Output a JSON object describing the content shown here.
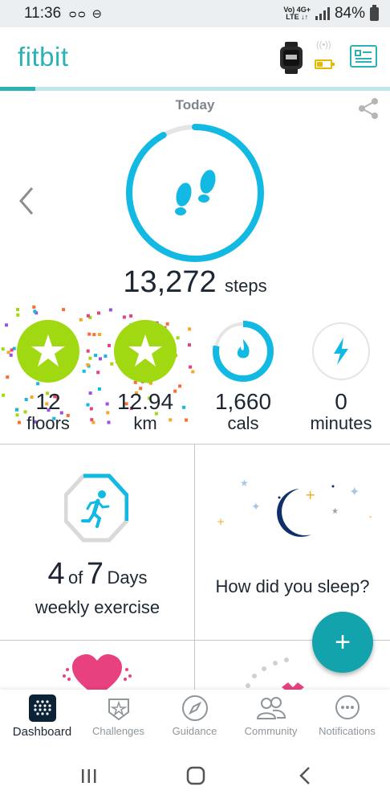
{
  "status_bar": {
    "time": "11:36",
    "left_icons": "ᴑᴑ ⊖",
    "network_line1": "Vo) 4G+",
    "network_line2": "LTE ↓↑",
    "battery": "84%"
  },
  "header": {
    "logo": "fitbit",
    "sync_progress": 0.09,
    "icons": [
      "watch-icon",
      "wifi-signal-icon",
      "battery-low-icon",
      "profile-card-icon"
    ]
  },
  "dashboard": {
    "day_label": "Today",
    "steps": {
      "value": "13,272",
      "unit": "steps",
      "goal_fraction": 0.92
    },
    "stats": [
      {
        "value": "12",
        "unit": "floors",
        "goal_met": true
      },
      {
        "value": "12.94",
        "unit": "km",
        "goal_met": true
      },
      {
        "value": "1,660",
        "unit": "cals",
        "goal_fraction": 0.78
      },
      {
        "value": "0",
        "unit": "minutes",
        "goal_fraction": 0
      }
    ],
    "exercise_tile": {
      "count": "4",
      "of": "of",
      "target": "7",
      "days": "Days",
      "label": "weekly exercise",
      "fraction": 0.57
    },
    "sleep_tile": {
      "question": "How did you sleep?"
    },
    "fab_label": "+"
  },
  "bottom_nav": [
    {
      "label": "Dashboard",
      "icon": "dashboard-icon",
      "active": true
    },
    {
      "label": "Challenges",
      "icon": "challenges-icon",
      "active": false
    },
    {
      "label": "Guidance",
      "icon": "guidance-icon",
      "active": false
    },
    {
      "label": "Community",
      "icon": "community-icon",
      "active": false
    },
    {
      "label": "Notifications",
      "icon": "notifications-icon",
      "active": false
    }
  ],
  "colors": {
    "teal": "#2ab2b5",
    "ring_blue": "#11b9e3",
    "green": "#a0d911",
    "fab": "#12a3ad"
  }
}
